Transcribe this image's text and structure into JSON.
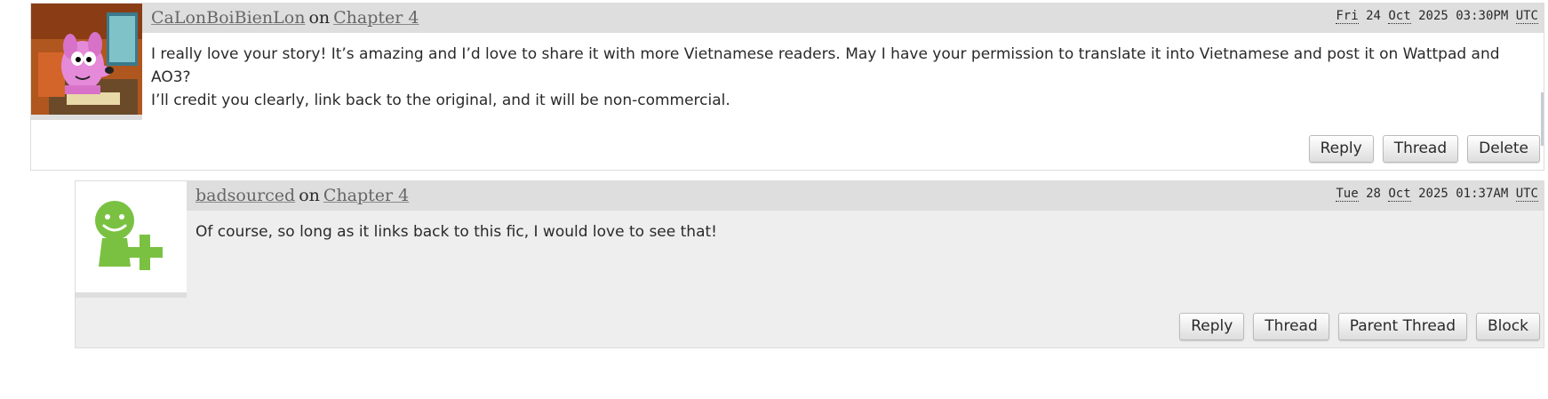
{
  "comments": [
    {
      "author": "CaLonBoiBienLon",
      "on_word": "on",
      "chapter": "Chapter 4",
      "date": {
        "day": "Fri",
        "rest": "24",
        "month": "Oct",
        "year_time": "2025 03:30PM",
        "tz": "UTC"
      },
      "body_lines": [
        "I really love your story! It’s amazing and I’d love to share it with more Vietnamese readers. May I have your permission to translate it into Vietnamese and post it on Wattpad and AO3?",
        "I’ll credit you clearly, link back to the original, and it will be non-commercial."
      ],
      "actions": [
        "Reply",
        "Thread",
        "Delete"
      ],
      "avatar_icon": "cartoon-dog-avatar"
    },
    {
      "author": "badsourced",
      "on_word": "on",
      "chapter": "Chapter 4",
      "date": {
        "day": "Tue",
        "rest": "28",
        "month": "Oct",
        "year_time": "2025 01:37AM",
        "tz": "UTC"
      },
      "body_lines": [
        "Of course, so long as it links back to this fic, I would love to see that!"
      ],
      "actions": [
        "Reply",
        "Thread",
        "Parent Thread",
        "Block"
      ],
      "avatar_icon": "default-user-add-icon"
    }
  ],
  "colors": {
    "header_bg": "#dedede",
    "reply_bg": "#eeeeee",
    "link": "#666666",
    "avatar_green": "#7ac142"
  }
}
